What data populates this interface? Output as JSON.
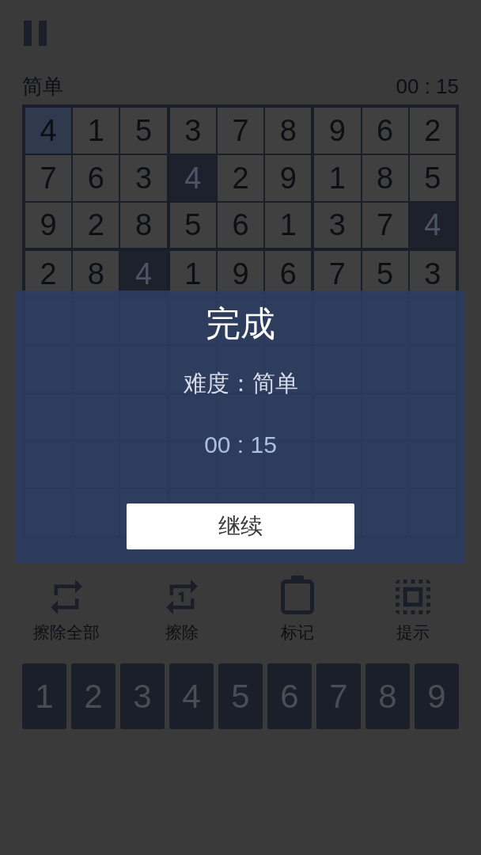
{
  "header": {
    "difficulty": "简单",
    "timer": "00 : 15"
  },
  "board": {
    "rows": [
      [
        {
          "digit": "4",
          "selected": true,
          "highlighted": false
        },
        {
          "digit": "1",
          "selected": false,
          "highlighted": false
        },
        {
          "digit": "5",
          "selected": false,
          "highlighted": false
        },
        {
          "digit": "3",
          "selected": false,
          "highlighted": false
        },
        {
          "digit": "7",
          "selected": false,
          "highlighted": false
        },
        {
          "digit": "8",
          "selected": false,
          "highlighted": false
        },
        {
          "digit": "9",
          "selected": false,
          "highlighted": false
        },
        {
          "digit": "6",
          "selected": false,
          "highlighted": false
        },
        {
          "digit": "2",
          "selected": false,
          "highlighted": false
        }
      ],
      [
        {
          "digit": "7",
          "selected": false,
          "highlighted": false
        },
        {
          "digit": "6",
          "selected": false,
          "highlighted": false
        },
        {
          "digit": "3",
          "selected": false,
          "highlighted": false
        },
        {
          "digit": "4",
          "selected": false,
          "highlighted": true
        },
        {
          "digit": "2",
          "selected": false,
          "highlighted": false
        },
        {
          "digit": "9",
          "selected": false,
          "highlighted": false
        },
        {
          "digit": "1",
          "selected": false,
          "highlighted": false
        },
        {
          "digit": "8",
          "selected": false,
          "highlighted": false
        },
        {
          "digit": "5",
          "selected": false,
          "highlighted": false
        }
      ],
      [
        {
          "digit": "9",
          "selected": false,
          "highlighted": false
        },
        {
          "digit": "2",
          "selected": false,
          "highlighted": false
        },
        {
          "digit": "8",
          "selected": false,
          "highlighted": false
        },
        {
          "digit": "5",
          "selected": false,
          "highlighted": false
        },
        {
          "digit": "6",
          "selected": false,
          "highlighted": false
        },
        {
          "digit": "1",
          "selected": false,
          "highlighted": false
        },
        {
          "digit": "3",
          "selected": false,
          "highlighted": false
        },
        {
          "digit": "7",
          "selected": false,
          "highlighted": false
        },
        {
          "digit": "4",
          "selected": false,
          "highlighted": true
        }
      ],
      [
        {
          "digit": "2",
          "selected": false,
          "highlighted": false
        },
        {
          "digit": "8",
          "selected": false,
          "highlighted": false
        },
        {
          "digit": "4",
          "selected": false,
          "highlighted": true
        },
        {
          "digit": "1",
          "selected": false,
          "highlighted": false
        },
        {
          "digit": "9",
          "selected": false,
          "highlighted": false
        },
        {
          "digit": "6",
          "selected": false,
          "highlighted": false
        },
        {
          "digit": "7",
          "selected": false,
          "highlighted": false
        },
        {
          "digit": "5",
          "selected": false,
          "highlighted": false
        },
        {
          "digit": "3",
          "selected": false,
          "highlighted": false
        }
      ]
    ]
  },
  "tools": [
    {
      "kind": "erase_all",
      "label": "擦除全部"
    },
    {
      "kind": "erase",
      "label": "擦除"
    },
    {
      "kind": "notes",
      "label": "标记"
    },
    {
      "kind": "hint",
      "label": "提示"
    }
  ],
  "number_pad": [
    "1",
    "2",
    "3",
    "4",
    "5",
    "6",
    "7",
    "8",
    "9"
  ],
  "dialog": {
    "title": "完成",
    "difficulty": "难度：简单",
    "time": "00 : 15",
    "button": "继续"
  }
}
